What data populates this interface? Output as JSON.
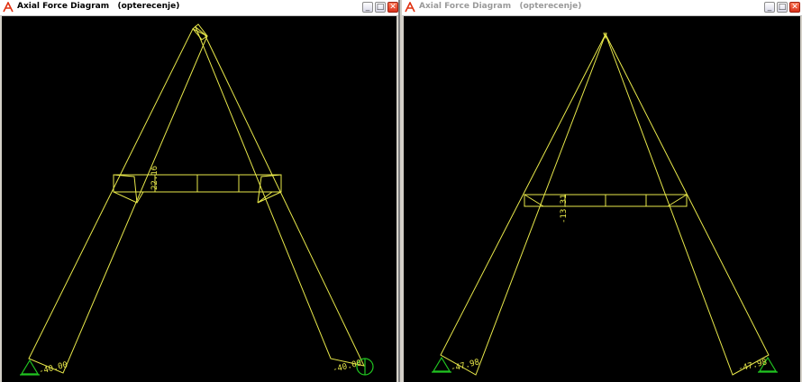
{
  "left_window": {
    "title": "Axial Force Diagram   (opterecenje)",
    "active": true,
    "labels": {
      "beam_force": "22.16",
      "left_support_force": "-40.00",
      "right_support_force": "-40.00"
    }
  },
  "right_window": {
    "title": "Axial Force Diagram   (opterecenje)",
    "active": false,
    "labels": {
      "beam_force": "-13.31",
      "left_support_force": "-47.98",
      "right_support_force": "-47.98"
    }
  },
  "controls": {
    "minimize": "_",
    "maximize": "□",
    "close": "✕"
  },
  "colors": {
    "diagram": "#e8e84a",
    "support": "#21c521",
    "background": "#000000",
    "title_active": "#000000",
    "title_inactive": "#9a9a9a"
  }
}
